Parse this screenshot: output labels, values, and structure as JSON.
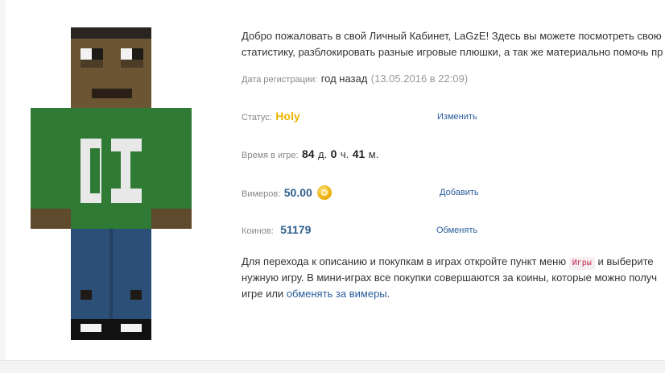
{
  "welcome": {
    "line1": "Добро пожаловать в свой Личный Кабинет, LaGzE! Здесь вы можете посмотреть свою",
    "line2": "статистику, разблокировать разные игровые плюшки, а так же материально помочь пр"
  },
  "registration": {
    "label": "Дата регистрации:",
    "relative": "год назад",
    "exact": "(13.05.2016 в 22:09)"
  },
  "status": {
    "label": "Статус:",
    "value": "Holy",
    "action": "Изменить"
  },
  "playtime": {
    "label": "Время в игре:",
    "days": "84",
    "days_unit": "д.",
    "hours": "0",
    "hours_unit": "ч.",
    "minutes": "41",
    "minutes_unit": "м."
  },
  "vimers": {
    "label": "Вимеров:",
    "value": "50.00",
    "icon": "coin-icon",
    "action": "Добавить"
  },
  "coins": {
    "label": "Коинов:",
    "value": "51179",
    "action": "Обменять"
  },
  "info": {
    "line1_a": "Для перехода к описанию и покупкам в играх откройте пункт меню",
    "menu_badge": "Игры",
    "line1_b": "и выберите",
    "line2": "нужную игру. В мини-играх все покупки совершаются за коины, которые можно получ",
    "line3_a": "игре или",
    "link": "обменять за вимеры",
    "line3_b": "."
  },
  "colors": {
    "status": "#f0b400",
    "link": "#2a5d9c",
    "value_blue": "#2f5f8e",
    "badge_text": "#c7254e",
    "skin_shirt": "#2f7a34",
    "skin_pants": "#2c4f78",
    "skin_face": "#6b5532"
  }
}
